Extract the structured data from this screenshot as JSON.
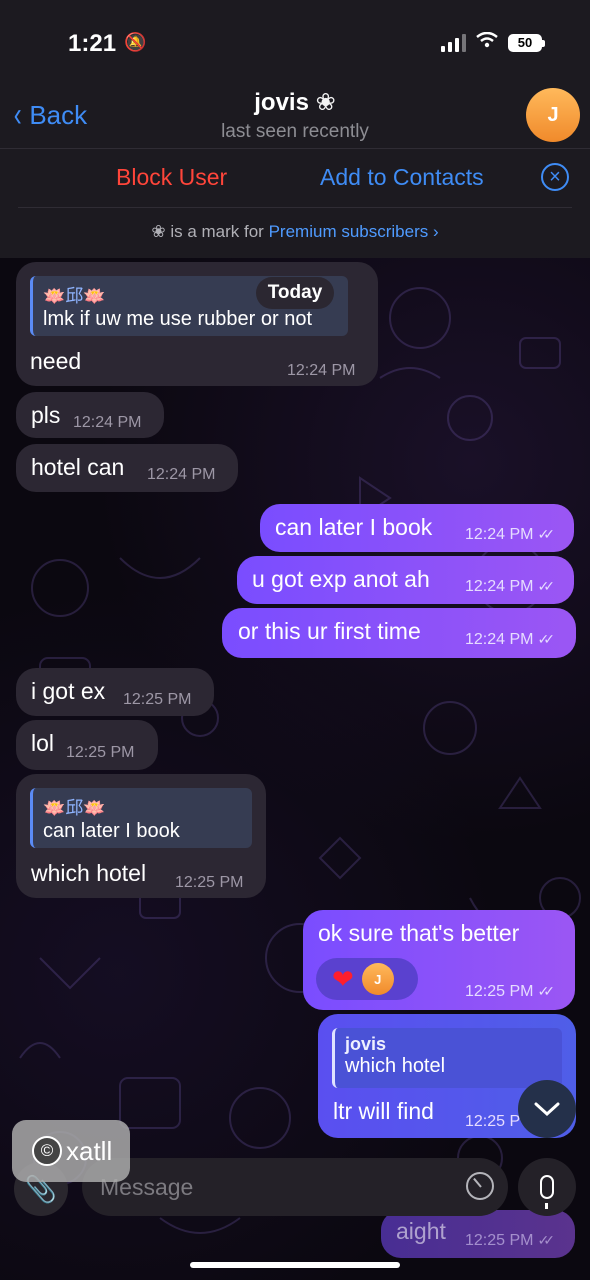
{
  "status_bar": {
    "time": "1:21",
    "battery": "50"
  },
  "nav": {
    "back_label": "Back",
    "contact_name": "jovis",
    "name_badge": "❀",
    "last_seen": "last seen recently",
    "avatar_initial": "J"
  },
  "actions": {
    "block_label": "Block User",
    "add_label": "Add to Contacts"
  },
  "premium_note": {
    "prefix": "is a mark for",
    "link": "Premium subscribers",
    "badge": "❀",
    "chevron": "›"
  },
  "date_pill": "Today",
  "messages": [
    {
      "reply_name": "🪷邱🪷",
      "reply_text": "lmk if uw me use rubber or not",
      "text": "need",
      "time": "12:24 PM"
    },
    {
      "text": "pls",
      "time": "12:24 PM"
    },
    {
      "text": "hotel can",
      "time": "12:24 PM"
    },
    {
      "text": "can later I book",
      "time": "12:24 PM"
    },
    {
      "text": "u got exp anot ah",
      "time": "12:24 PM"
    },
    {
      "text": "or this ur first time",
      "time": "12:24 PM"
    },
    {
      "text": "i got ex",
      "time": "12:25 PM"
    },
    {
      "text": "lol",
      "time": "12:25 PM"
    },
    {
      "reply_name": "🪷邱🪷",
      "reply_text": "can later I book",
      "text": "which hotel",
      "time": "12:25 PM"
    },
    {
      "text": "ok sure that's better",
      "time": "12:25 PM",
      "reaction": "❤",
      "reaction_avatar": "J"
    },
    {
      "reply_name": "jovis",
      "reply_text": "which hotel",
      "text": "ltr will find",
      "time": "12:25 P"
    },
    {
      "text": "aight",
      "time": "12:25 PM"
    }
  ],
  "composer": {
    "placeholder": "Message"
  },
  "watermark": {
    "symbol": "©",
    "text": "xatll"
  }
}
